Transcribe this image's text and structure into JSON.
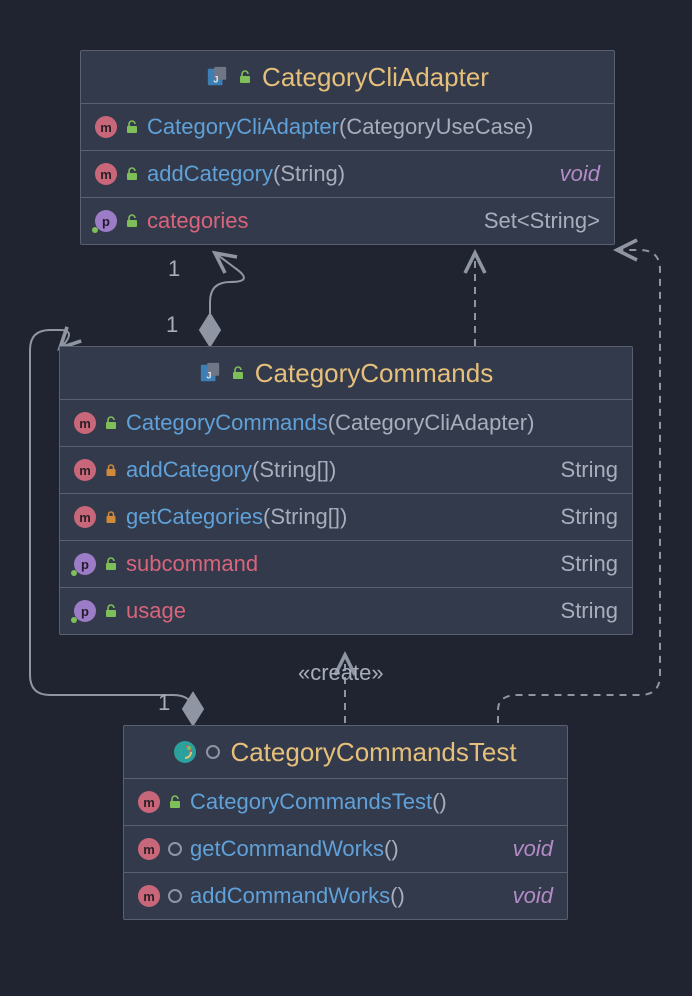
{
  "classes": {
    "adapter": {
      "name": "CategoryCliAdapter",
      "ctor": {
        "name": "CategoryCliAdapter",
        "param": "CategoryUseCase"
      },
      "m1": {
        "name": "addCategory",
        "param": "String",
        "ret": "void"
      },
      "p1": {
        "name": "categories",
        "ret": "Set<String>"
      }
    },
    "commands": {
      "name": "CategoryCommands",
      "ctor": {
        "name": "CategoryCommands",
        "param": "CategoryCliAdapter"
      },
      "m1": {
        "name": "addCategory",
        "param": "String[]",
        "ret": "String"
      },
      "m2": {
        "name": "getCategories",
        "param": "String[]",
        "ret": "String"
      },
      "p1": {
        "name": "subcommand",
        "ret": "String"
      },
      "p2": {
        "name": "usage",
        "ret": "String"
      }
    },
    "test": {
      "name": "CategoryCommandsTest",
      "ctor": {
        "name": "CategoryCommandsTest"
      },
      "m1": {
        "name": "getCommandWorks",
        "ret": "void"
      },
      "m2": {
        "name": "addCommandWorks",
        "ret": "void"
      }
    }
  },
  "labels": {
    "one_top": "1",
    "one_mid": "1",
    "one_bot": "1",
    "create": "«create»"
  }
}
